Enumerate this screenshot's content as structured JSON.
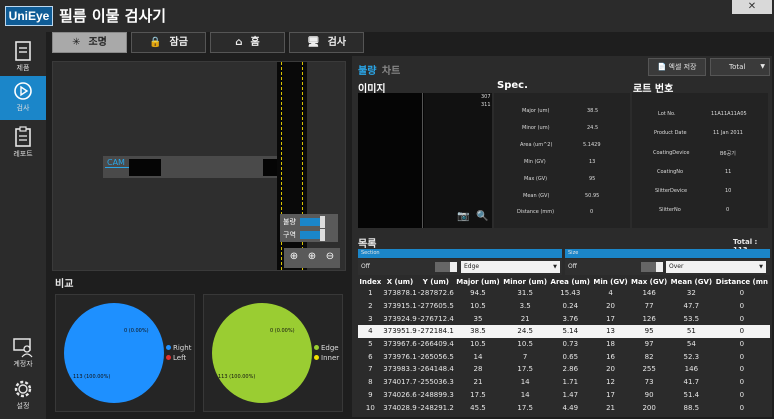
{
  "app": {
    "logo": "UniEye",
    "title": "필름 이물 검사기",
    "close": "✕"
  },
  "sidebar": {
    "items": [
      {
        "label": "제품",
        "icon": "document-icon",
        "active": false
      },
      {
        "label": "검사",
        "icon": "play-circle-icon",
        "active": true
      },
      {
        "label": "레포트",
        "icon": "clipboard-icon",
        "active": false
      },
      {
        "label": "계정자",
        "icon": "user-monitor-icon",
        "active": false
      },
      {
        "label": "설정",
        "icon": "gear-icon",
        "active": false
      }
    ]
  },
  "toolbar": {
    "light": {
      "label": "조명",
      "icon": "✳",
      "active": true
    },
    "lock": {
      "label": "잠금",
      "icon": "🔒",
      "active": false
    },
    "home": {
      "label": "홈",
      "icon": "⌂",
      "active": false
    },
    "inspect": {
      "label": "검사",
      "icon": "🖥",
      "active": false
    }
  },
  "camera": {
    "label": "CAM",
    "readout_a": "307",
    "readout_b": "311",
    "toggles": [
      {
        "label": "불량"
      },
      {
        "label": "구역"
      }
    ],
    "zoom": [
      "⊕",
      "⊕",
      "⊖"
    ]
  },
  "compare": {
    "title": "비교",
    "pies": [
      {
        "top_label": "0 (0.00%)",
        "bottom_label": "113 (100.00%)",
        "color": "#1e90ff",
        "legend": [
          {
            "name": "Right",
            "color": "#1e90ff"
          },
          {
            "name": "Left",
            "color": "#e03030"
          }
        ]
      },
      {
        "top_label": "0 (0.00%)",
        "bottom_label": "113 (100.00%)",
        "color": "#9acd32",
        "legend": [
          {
            "name": "Edge",
            "color": "#9acd32"
          },
          {
            "name": "Inner",
            "color": "#f0e000"
          }
        ]
      }
    ]
  },
  "tabs": {
    "active": "불량",
    "inactive": "차트"
  },
  "actions": {
    "excel": "엑셀 저장",
    "excel_icon": "📄",
    "total_select": "Total",
    "total_caret": "▼"
  },
  "image": {
    "title": "이미지",
    "camera_icon": "📷",
    "search_icon": "🔍"
  },
  "spec": {
    "title": "Spec.",
    "rows": [
      {
        "k": "Major (um)",
        "v": "38.5"
      },
      {
        "k": "Minor (um)",
        "v": "24.5"
      },
      {
        "k": "Area (um^2)",
        "v": "5.1429"
      },
      {
        "k": "Min (GV)",
        "v": "13"
      },
      {
        "k": "Max (GV)",
        "v": "95"
      },
      {
        "k": "Mean (GV)",
        "v": "50.95"
      },
      {
        "k": "Distance (mm)",
        "v": "0"
      }
    ]
  },
  "lot": {
    "title": "로트 번호",
    "rows": [
      {
        "k": "Lot No.",
        "v": "11A11A11A05"
      },
      {
        "k": "Product Date",
        "v": "11 Jan 2011"
      },
      {
        "k": "CoatingDevice",
        "v": "B6공기"
      },
      {
        "k": "CoatingNo",
        "v": "11"
      },
      {
        "k": "SlitterDevice",
        "v": "10"
      },
      {
        "k": "SlitterNo",
        "v": "0"
      }
    ]
  },
  "list": {
    "title": "목록",
    "total": "Total : 113",
    "filters": [
      {
        "header": "Section",
        "off": "Off",
        "select": "Edge",
        "caret": "▼"
      },
      {
        "header": "Size",
        "off": "Off",
        "select": "Over",
        "caret": "▼"
      }
    ],
    "columns": [
      "Index",
      "X (um)",
      "Y (um)",
      "Major (um)",
      "Minor (um)",
      "Area (um)",
      "Min (GV)",
      "Max (GV)",
      "Mean (GV)",
      "Distance (mn"
    ],
    "rows": [
      [
        "1",
        "373878.1",
        "-287872.6",
        "94.5",
        "31.5",
        "15.43",
        "4",
        "146",
        "32",
        "0"
      ],
      [
        "2",
        "373915.1",
        "-277605.5",
        "10.5",
        "3.5",
        "0.24",
        "20",
        "77",
        "47.7",
        "0"
      ],
      [
        "3",
        "373924.9",
        "-276712.4",
        "35",
        "21",
        "3.76",
        "17",
        "126",
        "53.5",
        "0"
      ],
      [
        "4",
        "373951.9",
        "-272184.1",
        "38.5",
        "24.5",
        "5.14",
        "13",
        "95",
        "51",
        "0"
      ],
      [
        "5",
        "373967.6",
        "-266409.4",
        "10.5",
        "10.5",
        "0.73",
        "18",
        "97",
        "54",
        "0"
      ],
      [
        "6",
        "373976.1",
        "-265056.5",
        "14",
        "7",
        "0.65",
        "16",
        "82",
        "52.3",
        "0"
      ],
      [
        "7",
        "373983.3",
        "-264148.4",
        "28",
        "17.5",
        "2.86",
        "20",
        "255",
        "146",
        "0"
      ],
      [
        "8",
        "374017.7",
        "-255036.3",
        "21",
        "14",
        "1.71",
        "12",
        "73",
        "41.7",
        "0"
      ],
      [
        "9",
        "374026.6",
        "-248899.3",
        "17.5",
        "14",
        "1.47",
        "17",
        "90",
        "51.4",
        "0"
      ],
      [
        "10",
        "374028.9",
        "-248291.2",
        "45.5",
        "17.5",
        "4.49",
        "21",
        "200",
        "88.5",
        "0"
      ]
    ],
    "selected_index": 3
  }
}
